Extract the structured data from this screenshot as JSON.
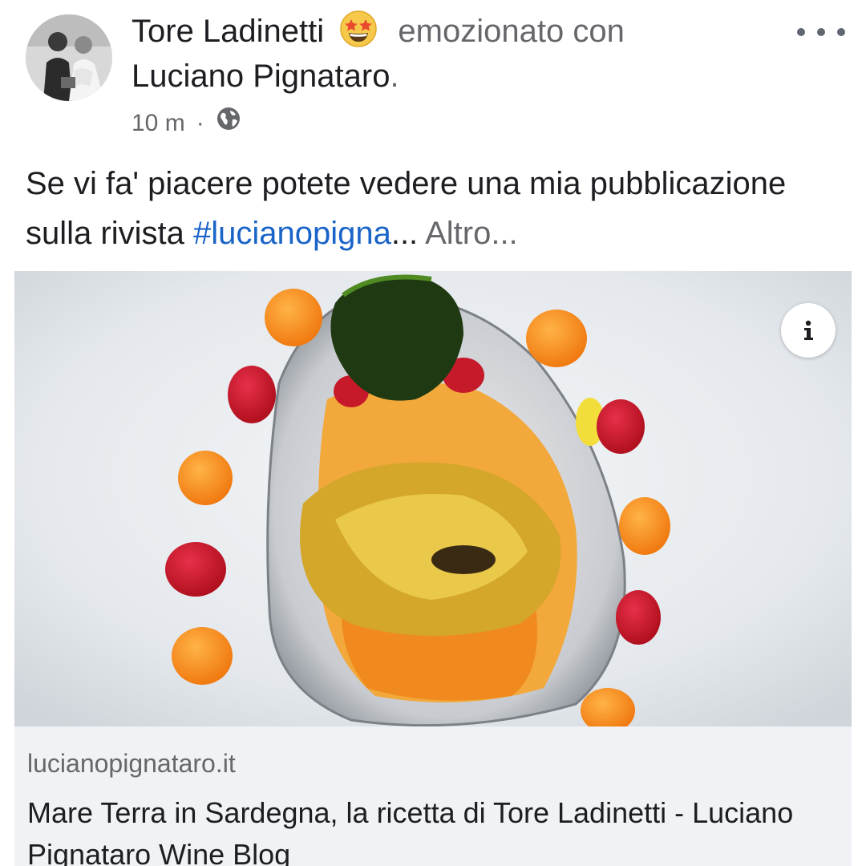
{
  "post": {
    "author": "Tore Ladinetti",
    "feeling_emoji": "star-struck-emoji",
    "feeling_text": "emozionato con",
    "tagged_user": "Luciano Pignataro",
    "period": ".",
    "time": "10 m",
    "separator": "·",
    "privacy_icon": "globe-icon",
    "more_icon": "more-options-icon",
    "text_prefix": "Se vi fa' piacere potete vedere una mia pubblicazione sulla rivista ",
    "hashtag": "#lucianopigna",
    "ellipsis": "...",
    "see_more": "Altro..."
  },
  "image": {
    "description_icon": "info-icon",
    "info_label": "i"
  },
  "link_preview": {
    "domain": "lucianopignataro.it",
    "title": "Mare Terra in Sardegna, la ricetta di Tore Ladinetti - Luciano Pignataro Wine Blog"
  },
  "colors": {
    "primary_text": "#1c1e21",
    "secondary_text": "#65676b",
    "link_blue": "#1a64c8",
    "card_background": "#f0f2f5"
  }
}
